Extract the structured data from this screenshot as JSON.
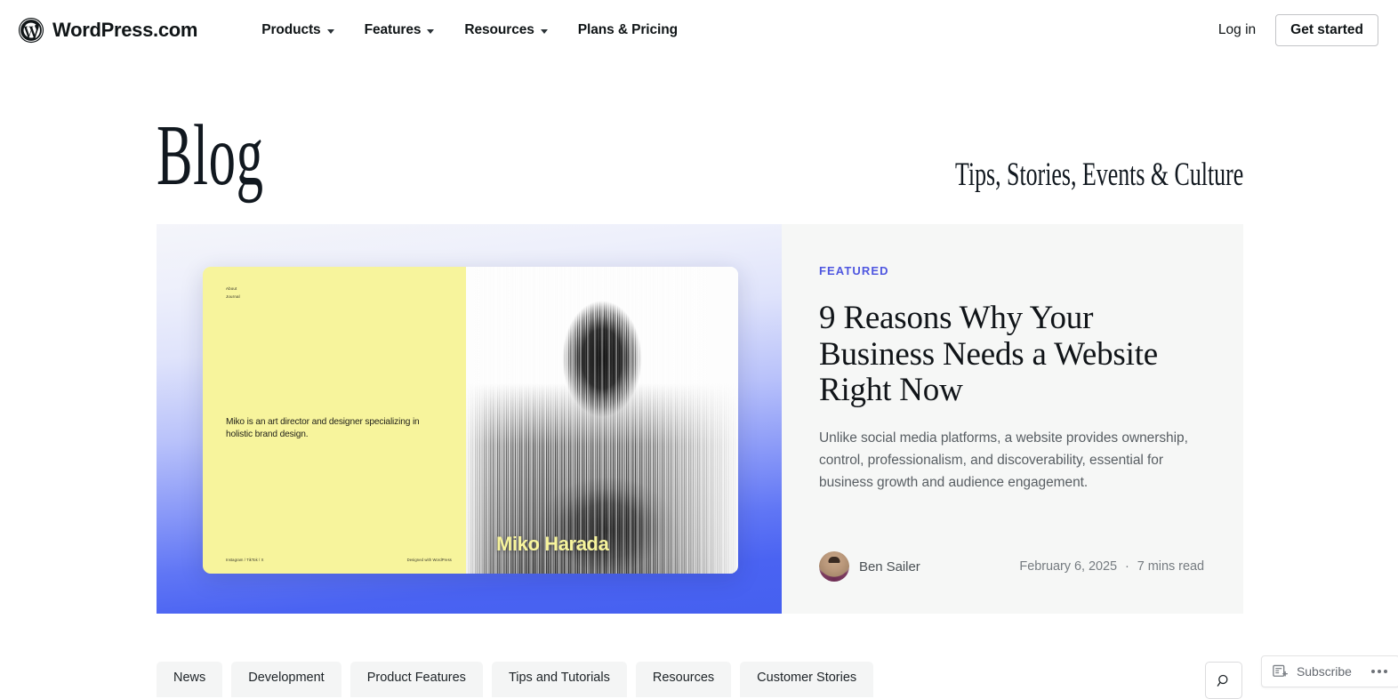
{
  "header": {
    "brand": "WordPress.com",
    "brand_icon": "wordpress-logo-icon",
    "nav": [
      {
        "label": "Products",
        "has_dropdown": true
      },
      {
        "label": "Features",
        "has_dropdown": true
      },
      {
        "label": "Resources",
        "has_dropdown": true
      },
      {
        "label": "Plans & Pricing",
        "has_dropdown": false
      }
    ],
    "login_label": "Log in",
    "get_started_label": "Get started"
  },
  "masthead": {
    "title": "Blog",
    "tagline": "Tips, Stories, Events & Culture"
  },
  "featured": {
    "eyebrow": "FEATURED",
    "title": "9 Reasons Why Your Business Needs a Website Right Now",
    "excerpt": "Unlike social media platforms, a website provides ownership, control, professionalism, and discoverability, essential for business growth and audience engagement.",
    "author": "Ben Sailer",
    "date": "February 6, 2025",
    "separator": "·",
    "read_time": "7 mins read",
    "image": {
      "alt": "Website mockup for art director Miko Harada",
      "mock_nav_line1": "About",
      "mock_nav_line2": "Journal",
      "mock_body": "Miko is an art director and designer specializing in holistic brand design.",
      "mock_footer_left": "Instagram / TikTok / X",
      "mock_footer_right": "Designed with WordPress",
      "mock_name": "Miko Harada"
    }
  },
  "tabs": [
    {
      "label": "News"
    },
    {
      "label": "Development"
    },
    {
      "label": "Product Features"
    },
    {
      "label": "Tips and Tutorials"
    },
    {
      "label": "Resources"
    },
    {
      "label": "Customer Stories"
    }
  ],
  "search": {
    "icon": "search-icon",
    "aria_label": "Search"
  },
  "subscribe_bar": {
    "icon": "subscribe-post-icon",
    "label": "Subscribe",
    "menu_icon": "ellipsis-icon"
  },
  "colors": {
    "accent_featured": "#4f57e0",
    "brand_dark": "#101517",
    "card_bg": "#f6f7f6",
    "tab_bg": "#f4f5f5",
    "mock_yellow": "#f7f49c",
    "gradient_blue": "#4560f0"
  }
}
